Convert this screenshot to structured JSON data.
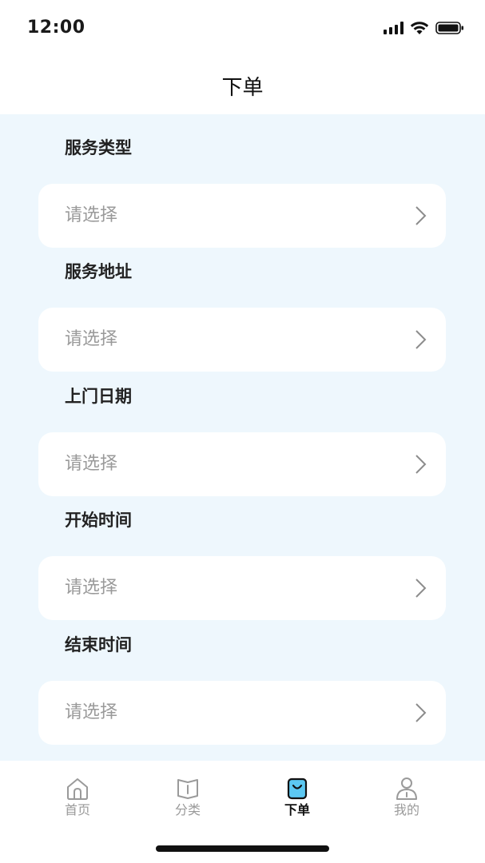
{
  "status_bar": {
    "time": "12:00"
  },
  "header": {
    "title": "下单"
  },
  "form": {
    "sections": [
      {
        "label": "服务类型",
        "placeholder": "请选择"
      },
      {
        "label": "服务地址",
        "placeholder": "请选择"
      },
      {
        "label": "上门日期",
        "placeholder": "请选择"
      },
      {
        "label": "开始时间",
        "placeholder": "请选择"
      },
      {
        "label": "结束时间",
        "placeholder": "请选择"
      }
    ]
  },
  "tab_bar": {
    "items": [
      {
        "label": "首页",
        "icon": "home-icon",
        "active": false
      },
      {
        "label": "分类",
        "icon": "book-icon",
        "active": false
      },
      {
        "label": "下单",
        "icon": "bag-icon",
        "active": true
      },
      {
        "label": "我的",
        "icon": "user-icon",
        "active": false
      }
    ]
  },
  "colors": {
    "content_background": "#eef7fd",
    "active_tab_accent": "#5cc8f2",
    "placeholder_text": "#9a9a9a"
  }
}
